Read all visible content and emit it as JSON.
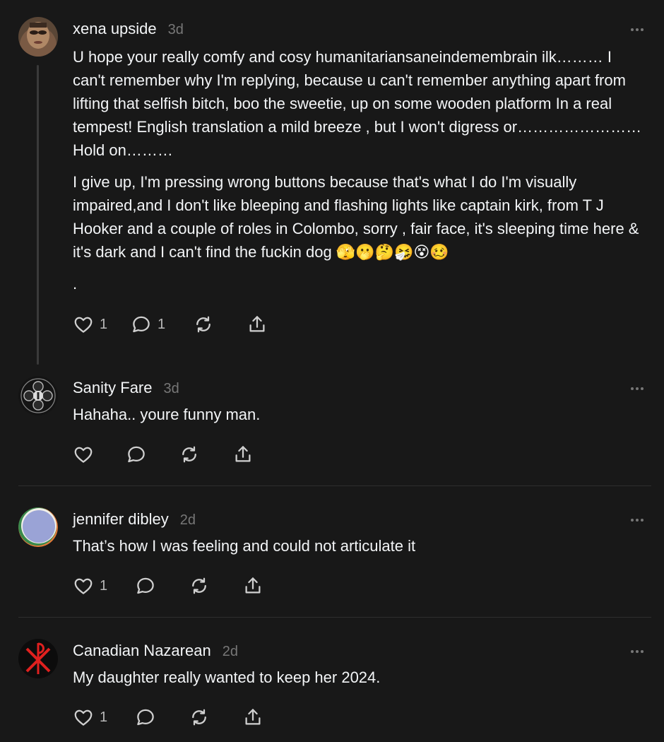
{
  "posts": [
    {
      "author": "xena upside",
      "time": "3d",
      "paragraphs": [
        "U hope your really comfy and cosy humanitariansaneindemembrain ilk……… I can't remember why I'm replying, because u can't remember anything apart from lifting that selfish bitch, boo the sweetie, up on some wooden platform In a real tempest! English translation a mild breeze , but I won't digress or…………………… Hold on………",
        "I give up, I'm pressing wrong buttons because that's what I do I'm visually impaired,and I don't like bleeping and flashing lights like captain kirk, from T J Hooker and a couple of roles in Colombo, sorry , fair face, it's sleeping time here & it's dark and I can't find the fuckin dog 🫣🫢🤔🤧😵🥴",
        "."
      ],
      "likes": "1",
      "replies": "1"
    },
    {
      "author": "Sanity Fare",
      "time": "3d",
      "paragraphs": [
        "Hahaha.. youre funny man."
      ],
      "likes": "",
      "replies": ""
    },
    {
      "author": "jennifer dibley",
      "time": "2d",
      "paragraphs": [
        "That’s how I was feeling and could not articulate it"
      ],
      "likes": "1",
      "replies": ""
    },
    {
      "author": "Canadian Nazarean",
      "time": "2d",
      "paragraphs": [
        "My daughter really wanted to keep her 2024."
      ],
      "likes": "1",
      "replies": ""
    }
  ],
  "icons": {
    "like": "heart-icon",
    "reply": "comment-icon",
    "repost": "repost-icon",
    "share": "share-icon",
    "more": "more-icon"
  },
  "colors": {
    "background": "#181818",
    "text": "#f3f5f7",
    "muted": "#777777",
    "divider": "#2e2e2e"
  }
}
